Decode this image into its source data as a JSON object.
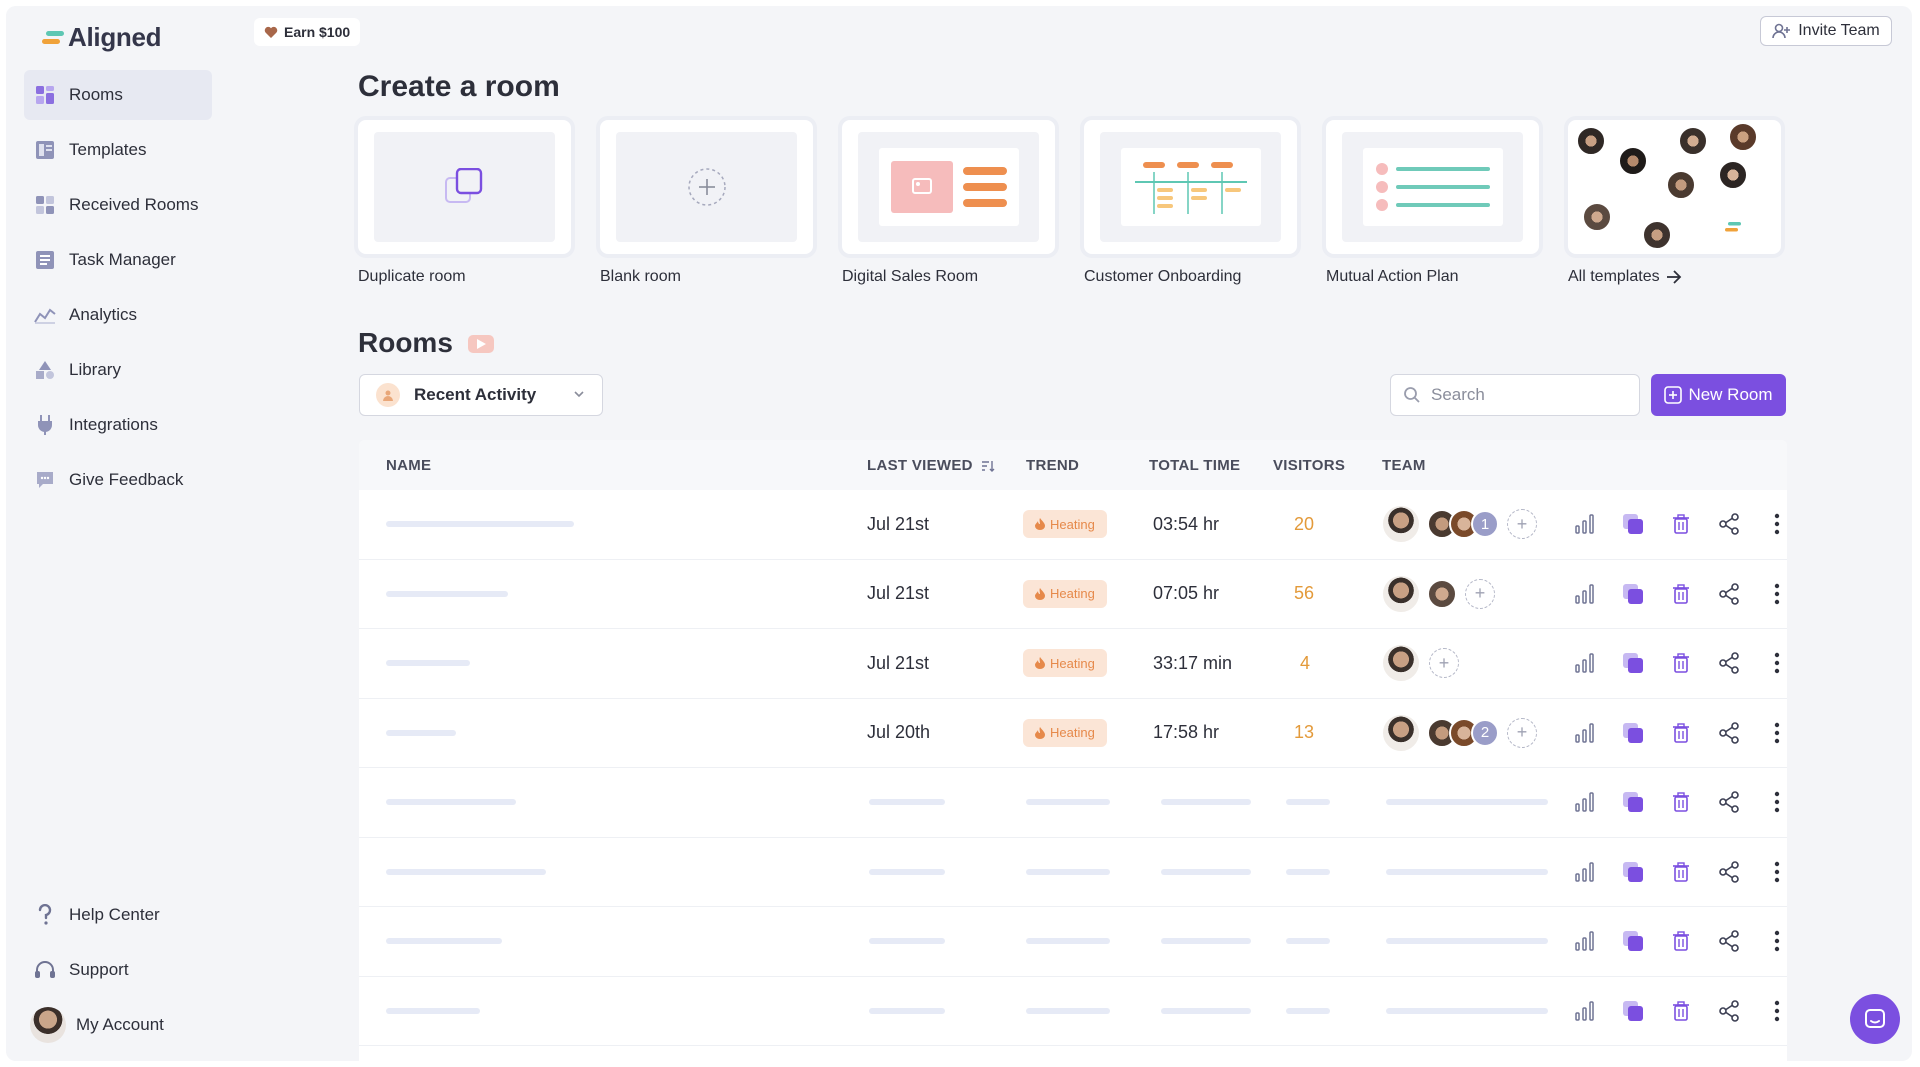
{
  "app": {
    "name": "Aligned"
  },
  "colors": {
    "accent": "#7b4fe0",
    "heating_bg": "#fbe5d6",
    "heating_text": "#e6894a",
    "visitors": "#e39a3a"
  },
  "sidebar": {
    "items": [
      {
        "label": "Rooms",
        "icon": "rooms-icon",
        "active": true
      },
      {
        "label": "Templates",
        "icon": "templates-icon"
      },
      {
        "label": "Received Rooms",
        "icon": "received-rooms-icon"
      },
      {
        "label": "Task Manager",
        "icon": "task-manager-icon"
      },
      {
        "label": "Analytics",
        "icon": "analytics-icon"
      },
      {
        "label": "Library",
        "icon": "library-icon"
      },
      {
        "label": "Integrations",
        "icon": "integrations-icon"
      },
      {
        "label": "Give Feedback",
        "icon": "feedback-icon"
      }
    ],
    "bottom": [
      {
        "label": "Help Center",
        "icon": "help-icon"
      },
      {
        "label": "Support",
        "icon": "headset-icon"
      },
      {
        "label": "My Account",
        "icon": "avatar"
      }
    ]
  },
  "topbar": {
    "earn_label": "Earn $100",
    "invite_label": "Invite Team"
  },
  "create": {
    "title": "Create a room",
    "cards": [
      {
        "label": "Duplicate room"
      },
      {
        "label": "Blank room"
      },
      {
        "label": "Digital Sales Room"
      },
      {
        "label": "Customer Onboarding"
      },
      {
        "label": "Mutual Action Plan"
      },
      {
        "label": "All templates"
      }
    ]
  },
  "rooms": {
    "title": "Rooms",
    "filter_label": "Recent Activity",
    "search_placeholder": "Search",
    "new_room_label": "New Room",
    "columns": {
      "name": "NAME",
      "last_viewed": "LAST VIEWED",
      "trend": "TREND",
      "total_time": "TOTAL TIME",
      "visitors": "VISITORS",
      "team": "TEAM"
    },
    "rows": [
      {
        "last_viewed": "Jul 21st",
        "trend": "Heating",
        "total_time": "03:54 hr",
        "visitors": "20",
        "extra_count": "1"
      },
      {
        "last_viewed": "Jul 21st",
        "trend": "Heating",
        "total_time": "07:05 hr",
        "visitors": "56",
        "extra_count": ""
      },
      {
        "last_viewed": "Jul 21st",
        "trend": "Heating",
        "total_time": "33:17 min",
        "visitors": "4",
        "extra_count": ""
      },
      {
        "last_viewed": "Jul 20th",
        "trend": "Heating",
        "total_time": "17:58 hr",
        "visitors": "13",
        "extra_count": "2"
      }
    ]
  }
}
